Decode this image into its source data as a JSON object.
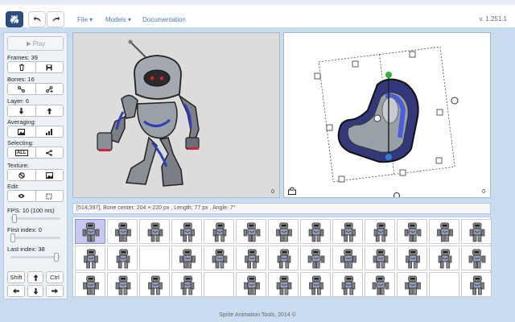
{
  "topbar": {
    "menus": [
      "File ▾",
      "Models ▾",
      "Documentation"
    ],
    "version": "v. 1.251.1",
    "buttons": [
      "mixer-icon",
      "undo-icon",
      "redo-icon"
    ]
  },
  "left": {
    "play_label": "Play",
    "frames_label": "Frames: 39",
    "bones_label": "Bones: 16",
    "layer_label": "Layer: 6",
    "averaging_label": "Averaging:",
    "selecting_label": "Selecting:",
    "all_label": "ALL",
    "texture_label": "Texture:",
    "edit_label": "Edit:",
    "fps_label": "FPS: 10 (100 ms)",
    "first_index_label": "First index: 0",
    "last_index_label": "Last index: 38",
    "shift_label": "Shift",
    "ctrl_label": "Ctrl"
  },
  "viewports": {
    "left_counter": "0",
    "right_counter": "0"
  },
  "status": {
    "text": "[514;397],  Bone center: 204 × 220 px ,  Length: 77 px ,  Angle: 7°"
  },
  "strip": {
    "rows": 3,
    "cols": 13,
    "selected_index": 0,
    "empty_cells": [
      15,
      30,
      37
    ]
  },
  "footer": {
    "text": "Sprite Animation Tools, 2014 ©"
  },
  "colors": {
    "accent": "#2b4e7e",
    "frame_bg": "#c9dcf0",
    "selection": "#c6c8f2",
    "robot_blue": "#2f3fb8",
    "robot_gray": "#8a8f96"
  }
}
